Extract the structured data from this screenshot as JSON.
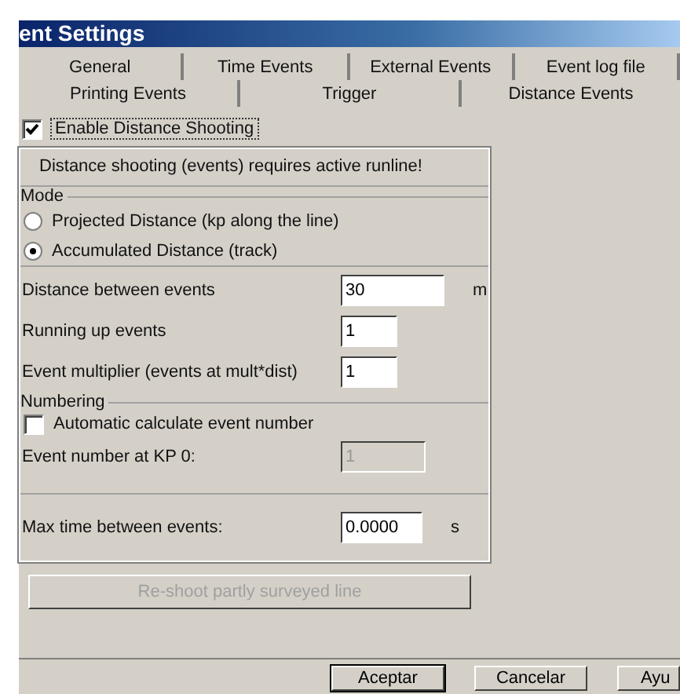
{
  "window": {
    "title": "ent Settings"
  },
  "tab_rows": [
    [
      {
        "label": "General",
        "selected": false
      },
      {
        "label": "Time Events",
        "selected": false
      },
      {
        "label": "External Events",
        "selected": false
      },
      {
        "label": "Event log file",
        "selected": false
      }
    ],
    [
      {
        "label": "Printing Events",
        "selected": false
      },
      {
        "label": "Trigger",
        "selected": false
      },
      {
        "label": "Distance Events",
        "selected": true
      }
    ]
  ],
  "enable": {
    "label": "Enable Distance Shooting",
    "checked": true
  },
  "warning": "Distance shooting (events) requires active runline!",
  "mode": {
    "title": "Mode",
    "options": [
      {
        "label": "Projected Distance (kp along the line)",
        "selected": false
      },
      {
        "label": "Accumulated Distance (track)",
        "selected": true
      }
    ]
  },
  "fields": [
    {
      "label": "Distance between events",
      "value": "30",
      "unit": "m",
      "wide": true
    },
    {
      "label": "Running up events",
      "value": "1",
      "wide": false
    },
    {
      "label": "Event multiplier (events at mult*dist)",
      "value": "1",
      "wide": false
    }
  ],
  "numbering": {
    "title": "Numbering",
    "auto": {
      "label": "Automatic calculate event number",
      "checked": false
    },
    "kp0": {
      "label": "Event number at KP 0:",
      "value": "1",
      "disabled": true
    }
  },
  "max_time": {
    "label": "Max time between events:",
    "value": "0.0000",
    "unit": "s"
  },
  "reshoot": {
    "label": "Re-shoot partly surveyed line",
    "disabled": true
  },
  "buttons": [
    "Aceptar",
    "Cancelar",
    "Ayu"
  ]
}
